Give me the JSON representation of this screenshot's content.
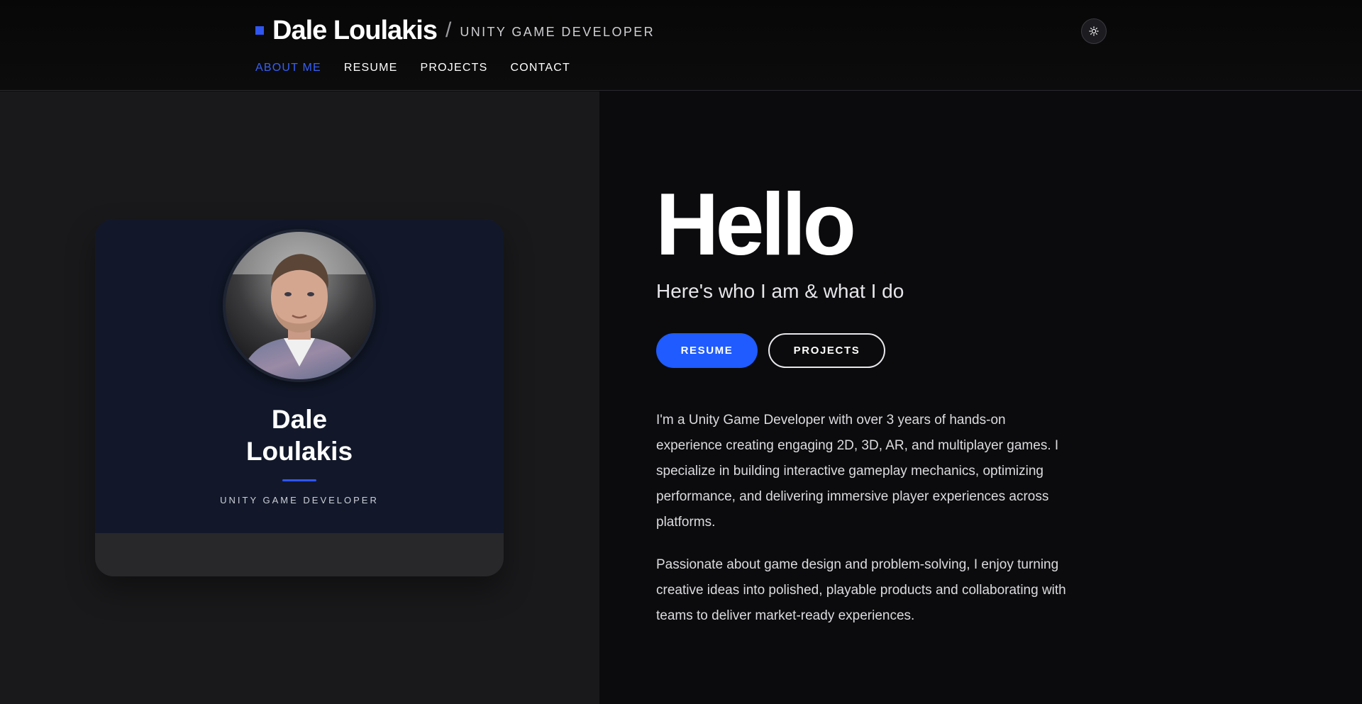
{
  "header": {
    "name": "Dale Loulakis",
    "separator": "/",
    "role": "UNITY GAME DEVELOPER",
    "theme_toggle_icon": "sun-icon"
  },
  "nav": {
    "items": [
      {
        "label": "ABOUT ME",
        "active": true
      },
      {
        "label": "RESUME",
        "active": false
      },
      {
        "label": "PROJECTS",
        "active": false
      },
      {
        "label": "CONTACT",
        "active": false
      }
    ]
  },
  "profile": {
    "name_line1": "Dale",
    "name_line2": "Loulakis",
    "role": "UNITY GAME DEVELOPER"
  },
  "hero": {
    "heading": "Hello",
    "tagline": "Here's who I am & what I do",
    "primary_button": "RESUME",
    "secondary_button": "PROJECTS",
    "bio_paragraph_1": "I'm a Unity Game Developer with over 3 years of hands-on experience creating engaging 2D, 3D, AR, and multiplayer games. I specialize in building interactive gameplay mechanics, optimizing performance, and delivering immersive player experiences across platforms.",
    "bio_paragraph_2": "Passionate about game design and problem-solving, I enjoy turning creative ideas into polished, playable products and collaborating with teams to deliver market-ready experiences."
  },
  "colors": {
    "accent": "#2f56f0",
    "primary_button": "#1f5bff",
    "active_nav": "#3760f5",
    "card_top": "#12182a",
    "left_panel": "#19191b",
    "right_panel": "#0b0b0d"
  }
}
